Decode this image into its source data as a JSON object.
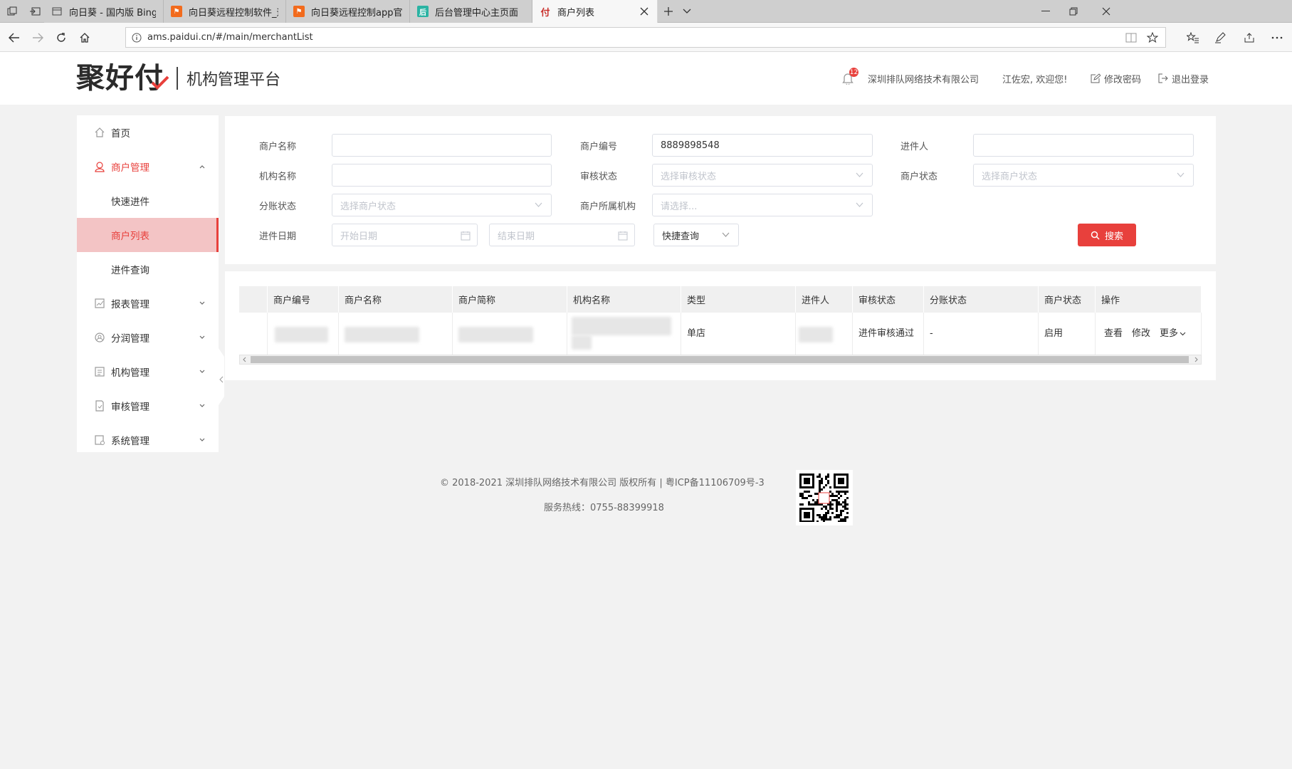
{
  "browser": {
    "tabs": [
      {
        "title": "向日葵 - 国内版 Bing",
        "icon": "page-icon",
        "active": false
      },
      {
        "title": "向日葵远程控制软件_远程控",
        "icon": "sunlogin-icon",
        "active": false
      },
      {
        "title": "向日葵远程控制app官方下载",
        "icon": "sunlogin-icon",
        "active": false
      },
      {
        "title": "后台管理中心主页面",
        "icon": "admin-icon",
        "active": false
      },
      {
        "title": "商户列表",
        "icon": "fu-logo-icon",
        "active": true
      }
    ],
    "url": "ams.paidui.cn/#/main/merchantList"
  },
  "header": {
    "logo_text": "聚好付",
    "platform": "机构管理平台",
    "notification_count": "12",
    "company": "深圳排队网络技术有限公司",
    "welcome": "江佐宏, 欢迎您!",
    "change_password": "修改密码",
    "logout": "退出登录"
  },
  "sidebar": {
    "items": [
      {
        "label": "首页",
        "icon": "home-icon"
      },
      {
        "label": "商户管理",
        "icon": "merchant-icon",
        "expanded": true
      },
      {
        "label": "快速进件"
      },
      {
        "label": "商户列表",
        "active": true
      },
      {
        "label": "进件查询"
      },
      {
        "label": "报表管理",
        "icon": "report-icon"
      },
      {
        "label": "分润管理",
        "icon": "profit-icon"
      },
      {
        "label": "机构管理",
        "icon": "institution-icon"
      },
      {
        "label": "审核管理",
        "icon": "audit-icon"
      },
      {
        "label": "系统管理",
        "icon": "system-icon"
      }
    ]
  },
  "search": {
    "merchant_name": {
      "label": "商户名称",
      "value": ""
    },
    "merchant_no": {
      "label": "商户编号",
      "value": "8889898548"
    },
    "applicant": {
      "label": "进件人",
      "value": ""
    },
    "org_name": {
      "label": "机构名称",
      "value": ""
    },
    "audit_status": {
      "label": "审核状态",
      "placeholder": "选择审核状态"
    },
    "merchant_status": {
      "label": "商户状态",
      "placeholder": "选择商户状态"
    },
    "split_status": {
      "label": "分账状态",
      "placeholder": "选择商户状态"
    },
    "merchant_org": {
      "label": "商户所属机构",
      "placeholder": "请选择..."
    },
    "apply_date": {
      "label": "进件日期",
      "start_placeholder": "开始日期",
      "end_placeholder": "结束日期"
    },
    "quick_query": "快捷查询",
    "search_button": "搜索"
  },
  "table": {
    "columns": [
      "",
      "商户编号",
      "商户名称",
      "商户简称",
      "机构名称",
      "类型",
      "进件人",
      "审核状态",
      "分账状态",
      "商户状态",
      "操作"
    ],
    "rows": [
      {
        "type": "单店",
        "audit_status": "进件审核通过",
        "split_status": "-",
        "merchant_status": "启用",
        "actions": [
          "查看",
          "修改",
          "更多"
        ]
      }
    ]
  },
  "footer": {
    "copyright": "© 2018-2021 深圳排队网络技术有限公司 版权所有 | 粤ICP备11106709号-3",
    "hotline": "服务热线：0755-88399918"
  },
  "colors": {
    "accent": "#e8403c",
    "active_bg": "#f3c4c5",
    "page_bg": "#f2f2f2"
  }
}
